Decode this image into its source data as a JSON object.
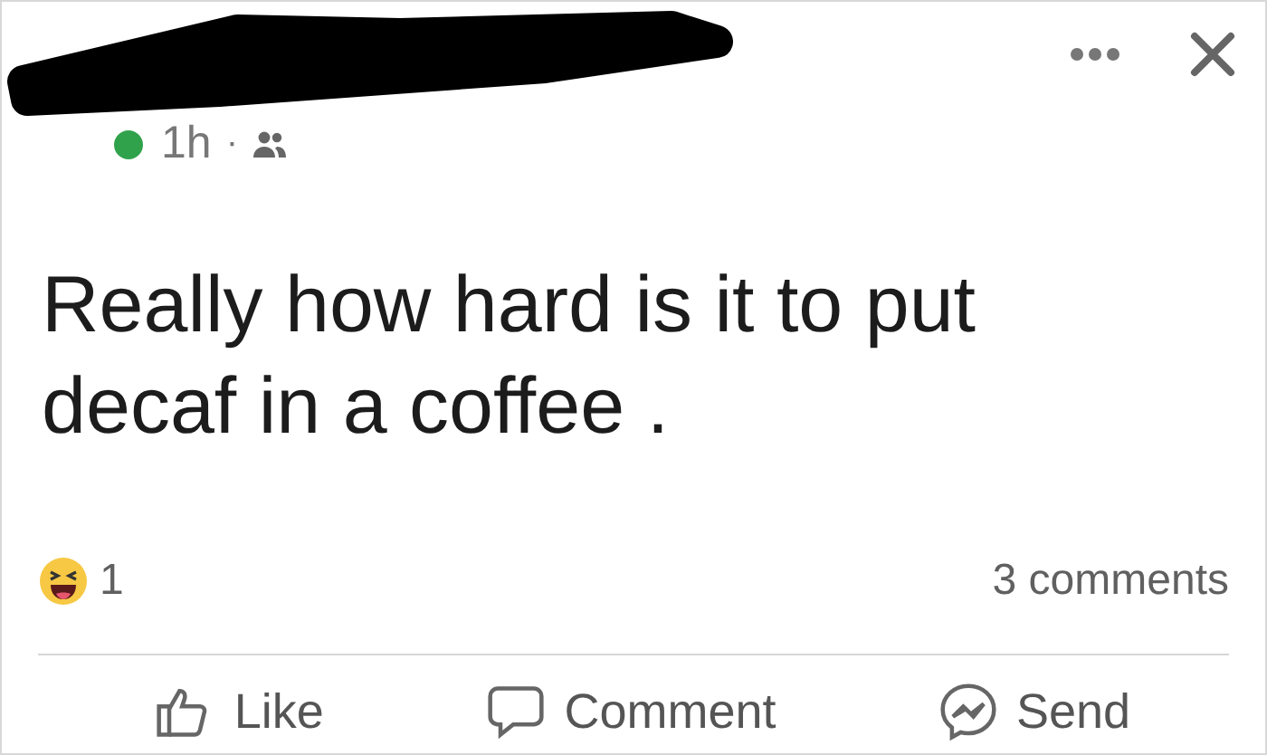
{
  "header": {
    "online": true,
    "time": "1h",
    "separator": "·"
  },
  "post": {
    "text": "Really how hard is it to put decaf in a coffee ."
  },
  "reactions": {
    "count": "1",
    "comments": "3 comments"
  },
  "actions": [
    {
      "kind": "like",
      "label": "Like"
    },
    {
      "kind": "comment",
      "label": "Comment"
    },
    {
      "kind": "send",
      "label": "Send"
    }
  ]
}
